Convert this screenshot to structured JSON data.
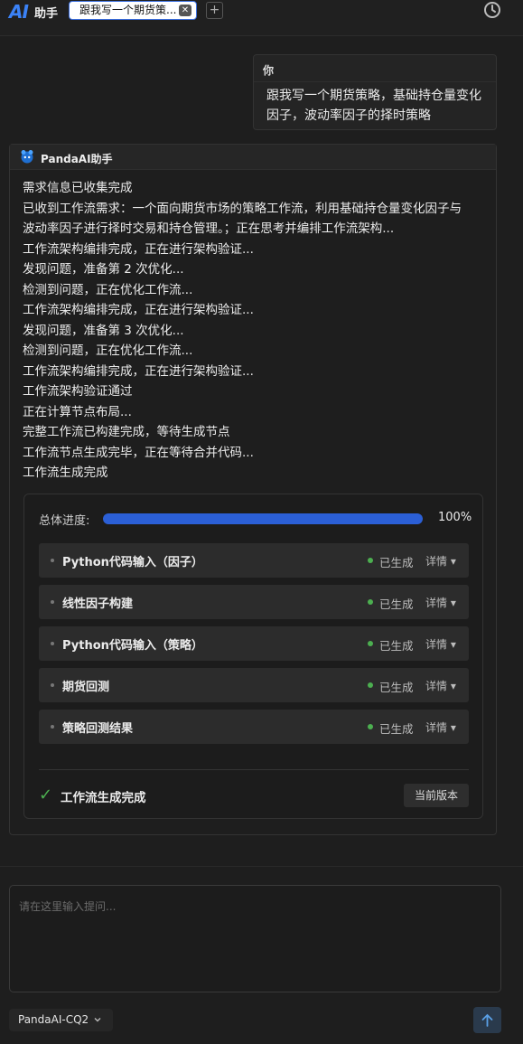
{
  "header": {
    "logo": "AI",
    "app_name": "助手",
    "tab_title": "跟我写一个期货策...",
    "tab_close": "✕",
    "add_tab": "+"
  },
  "user_message": {
    "sender": "你",
    "text": "跟我写一个期货策略，基础持仓量变化因子，波动率因子的择时策略"
  },
  "assistant": {
    "name": "PandaAI助手",
    "log": [
      "需求信息已收集完成",
      "已收到工作流需求：一个面向期货市场的策略工作流，利用基础持仓量变化因子与",
      "波动率因子进行择时交易和持仓管理。；正在思考并编排工作流架构...",
      "工作流架构编排完成，正在进行架构验证...",
      "发现问题，准备第 2 次优化...",
      "检测到问题，正在优化工作流...",
      "工作流架构编排完成，正在进行架构验证...",
      "发现问题，准备第 3 次优化...",
      "检测到问题，正在优化工作流...",
      "工作流架构编排完成，正在进行架构验证...",
      "工作流架构验证通过",
      "正在计算节点布局...",
      "完整工作流已构建完成，等待生成节点",
      "工作流节点生成完毕，正在等待合并代码...",
      "工作流生成完成"
    ],
    "progress": {
      "label": "总体进度:",
      "percent_text": "100%",
      "value": 1.0
    },
    "nodes": [
      {
        "name": "Python代码输入（因子）",
        "status": "已生成",
        "detail": "详情 ▾"
      },
      {
        "name": "线性因子构建",
        "status": "已生成",
        "detail": "详情 ▾"
      },
      {
        "name": "Python代码输入（策略）",
        "status": "已生成",
        "detail": "详情 ▾"
      },
      {
        "name": "期货回测",
        "status": "已生成",
        "detail": "详情 ▾"
      },
      {
        "name": "策略回测结果",
        "status": "已生成",
        "detail": "详情 ▾"
      }
    ],
    "done_text": "工作流生成完成",
    "version_button": "当前版本"
  },
  "input": {
    "placeholder": "请在这里输入提问...",
    "model": "PandaAI-CQ2"
  },
  "colors": {
    "accent": "#3b82f6",
    "status_green": "#4caf50",
    "background": "#1e1e1e"
  }
}
